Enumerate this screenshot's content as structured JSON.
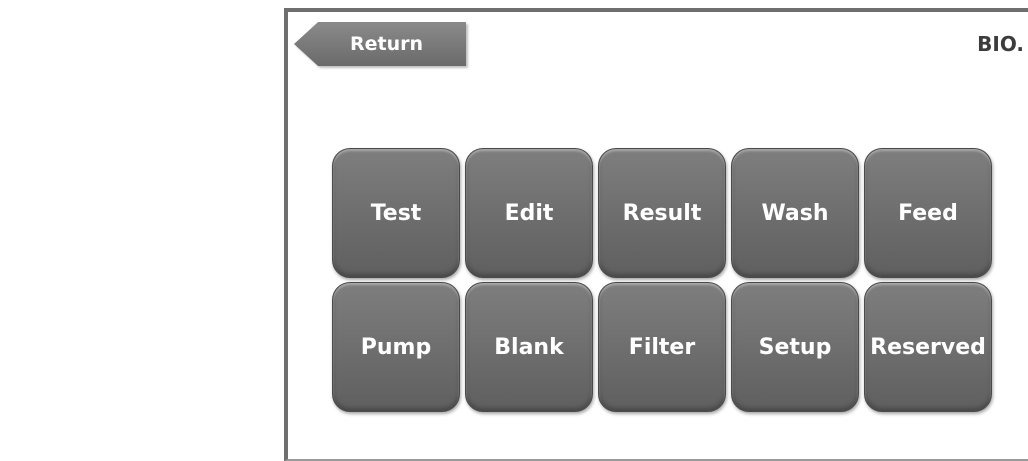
{
  "header": {
    "return_label": "Return",
    "brand": "BIO."
  },
  "menu": {
    "buttons": [
      {
        "label": "Test"
      },
      {
        "label": "Edit"
      },
      {
        "label": "Result"
      },
      {
        "label": "Wash"
      },
      {
        "label": "Feed"
      },
      {
        "label": "Pump"
      },
      {
        "label": "Blank"
      },
      {
        "label": "Filter"
      },
      {
        "label": "Setup"
      },
      {
        "label": "Reserved"
      }
    ]
  },
  "colors": {
    "button": "#6e6e6e",
    "frame": "#6f6f6f",
    "text": "#ffffff"
  },
  "icons": {
    "return": "left-arrow-tab-icon"
  }
}
